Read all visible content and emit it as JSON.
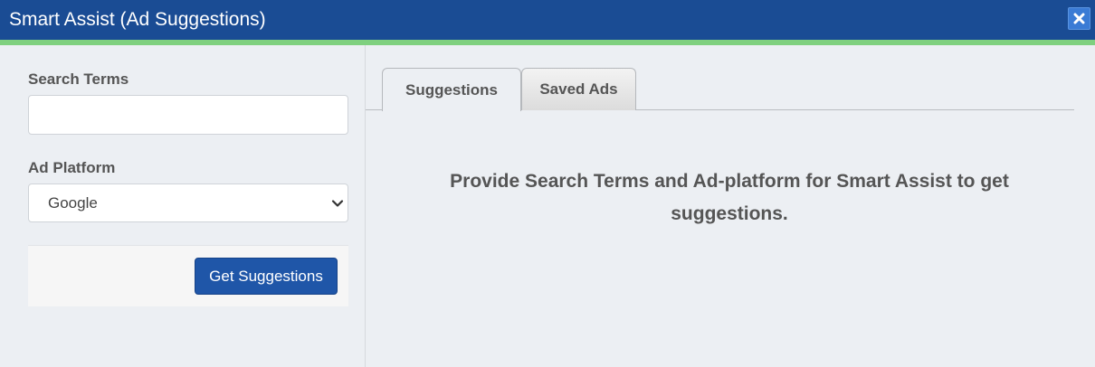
{
  "window": {
    "title": "Smart Assist (Ad Suggestions)",
    "close_icon": "close-icon",
    "colors": {
      "titlebar": "#1a4c94",
      "accent_stripe": "#7fd07f",
      "close_button": "#3a7bd5",
      "primary_button": "#1f56a8"
    }
  },
  "form": {
    "search_label": "Search Terms",
    "search_value": "",
    "search_placeholder": "",
    "platform_label": "Ad Platform",
    "platform_selected": "Google",
    "platform_chevron_icon": "chevron-down-icon",
    "submit_label": "Get Suggestions"
  },
  "tabs": [
    {
      "label": "Suggestions",
      "active": true
    },
    {
      "label": "Saved Ads",
      "active": false
    }
  ],
  "content": {
    "empty_message": "Provide Search Terms and Ad-platform for Smart Assist to get suggestions."
  }
}
